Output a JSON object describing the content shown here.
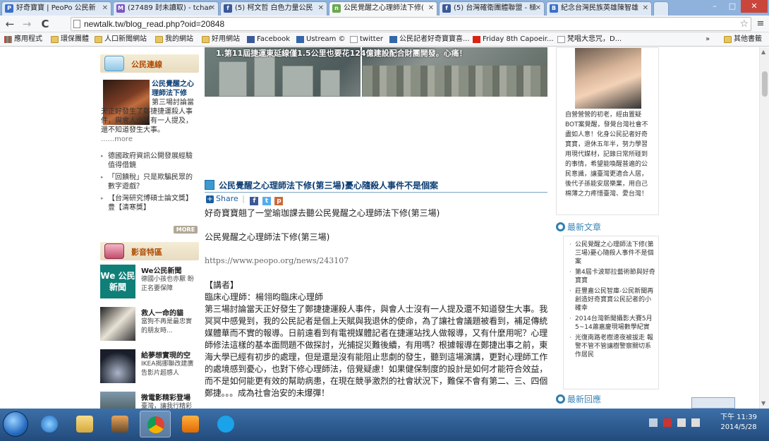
{
  "tabs": [
    {
      "label": "好奇寶寶 | PeoPo 公民新",
      "favicon": "P",
      "color": "#3b6fc9"
    },
    {
      "label": "(27489 封未讀取) - tchar",
      "favicon": "M",
      "color": "#7e57c2"
    },
    {
      "label": "(5) 柯文哲 白色力量公民",
      "favicon": "f",
      "color": "#3b5998"
    },
    {
      "label": "公民覺醒之心理師法下修(",
      "favicon": "n",
      "color": "#6aa84f"
    },
    {
      "label": "(5) 台灣確衛團體聯盟 - 極",
      "favicon": "f",
      "color": "#3b5998"
    },
    {
      "label": "紀念台灣民族英雄陳智雄",
      "favicon": "B",
      "color": "#3b6fc9"
    }
  ],
  "window_controls": {
    "minimize": "–",
    "maximize": "□",
    "close": "✕"
  },
  "address": {
    "url": "newtalk.tw/blog_read.php?oid=20848",
    "back": "←",
    "forward": "→",
    "reload": "C",
    "star": "☆",
    "menu": "≡"
  },
  "bookmarks": {
    "items": [
      "應用程式",
      "環保團體",
      "人口新聞網站",
      "我的網站",
      "好用網站",
      "Facebook",
      "Ustream ©",
      "twitter",
      "公民記者好奇寶寶喜...",
      "Friday 8th Capoeir...",
      "梵唱大悲咒，D..."
    ],
    "overflow": "»",
    "other": "其他書籤"
  },
  "left": {
    "citizen_section": "公民連線",
    "featured_title": "公民覺醒之心理師法下修",
    "featured_excerpt": "第三場討論當天正好發生了鄭捷捷運殺人事件，與會人士沒有一人提及，還不知道發生大事。",
    "more_link": "......more",
    "list": [
      "德國政府資訊公開發展經驗值得借鏡",
      "「回饋稅」只是欺騙民眾的數字遊戲？",
      "【台灣研究博碩士論文獎】豊【清寒獎】"
    ],
    "more_badge": "MORE",
    "video_section": "影音特區",
    "videos": [
      {
        "title": "We公民新聞",
        "desc": "德國小孩也亦厭 盼正名要保障",
        "thumb": "We 公民新聞"
      },
      {
        "title": "救人一命的貓",
        "desc": "當狗不再是最忠實的朋友時...",
        "thumb": ""
      },
      {
        "title": "給夢想實現的空",
        "desc": "IKEA揭挪聯改建廣告影片超感人",
        "thumb": ""
      },
      {
        "title": "微電影精彩登場",
        "desc": "臺灣，讓我行精彩",
        "thumb": ""
      }
    ]
  },
  "article": {
    "banner_caption": "1.第11屆捷運東延線僅1.5公里也要花124億建設配合財團開發。心痛！",
    "title": "公民覺醒之心理師法下修(第三場)憂心隨殺人事件不是個案",
    "share": "Share",
    "intro": "好奇寶寶翹了一堂瑜珈課去聽公民覺醒之心理師法下修(第三場)",
    "subtitle": "公民覺醒之心理師法下修(第三場)",
    "link": "https://www.peopo.org/news/243107",
    "speaker_label": "【講者】",
    "speaker": "臨床心理師：楊翎昀臨床心理師",
    "paragraph": "第三場討論當天正好發生了鄭捷捷運殺人事件，與會人士沒有一人提及還不知道發生大事。我冥冥中感覺到，我的公民記者是個上天賦與我退休的使命，為了讓社會議題被看到，補足傳統媒體華而不實的報導。日前遠看到有電視媒體記者在捷運站找人做報導，又有什麼用呢？心理師修法這樣的基本面問題不做探討，光捕捉災難後續，有用嗎？根據報導在鄭捷出事之前，東海大學已經有初步的處理，但是還是沒有能阻止悲劇的發生，聽到這場演講，更對心理師工作的處境感到憂心，也對下修心理師法，倍覺疑慮！如果健保制度的設計是如何才能符合效益，而不是如何能更有效的幫助病患，在現在競爭激烈的社會狀況下，難保不會有第二、三、四個鄭捷。。。成為社會治安的未爆彈！"
  },
  "right": {
    "profile_text": "自營營營的初老，經由置疑BOT案覺醒，發覺台灣社會不盡如人意！化身公民記者好奇寶寶，退休五年半，努力學習用現代媒材，記錄日常所碰到的事情，希望能喚醒普遍的公民意識，讓臺灣更適合人居，後代子孫能安居樂業，用自己棉薄之力疼惜臺灣、愛台灣！",
    "latest_heading": "最新文章",
    "latest": [
      "公民覺醒之心理師法下修(第三場)憂心隨殺人事件不是個案",
      "第4屆卡波耶拉藝術節與好奇寶寶",
      "莊豐嘉公民智庫-公民新聞再創造好奇寶寶公民記者的小確幸",
      "2014台灣新聞攝影大賽5月5~14蕭嘉慶現場數學紀實",
      "光復南路老樹速夜被拔走 報警不管不管讓樹警察關切系作居民"
    ],
    "replies_heading": "最新回應"
  },
  "taskbar": {
    "time": "下午 11:39",
    "date": "2014/5/28"
  }
}
